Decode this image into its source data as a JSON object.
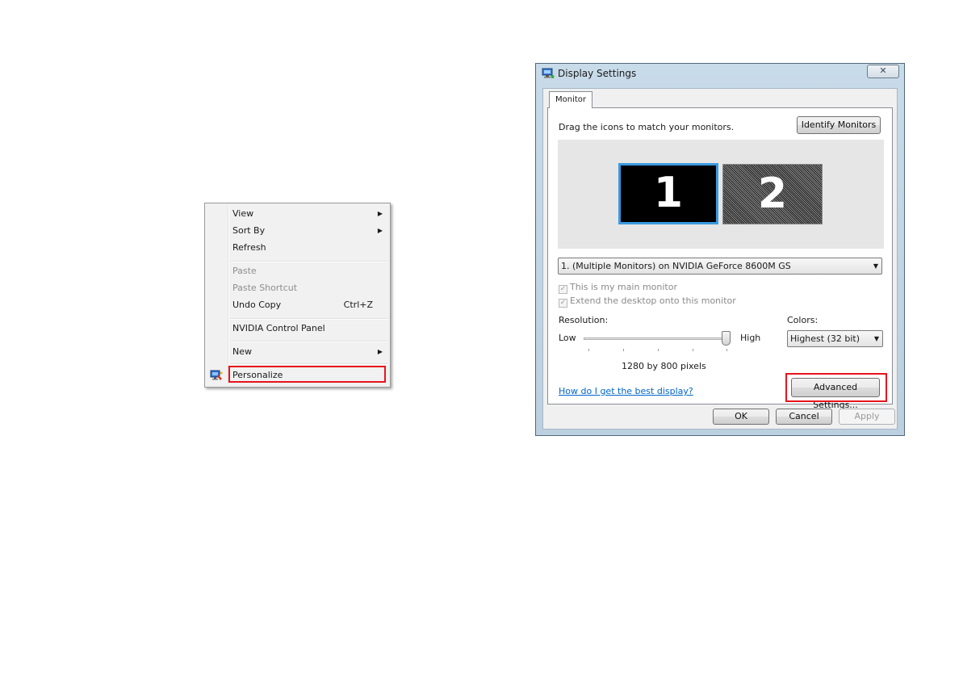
{
  "context_menu": {
    "items": [
      {
        "label": "View",
        "submenu": true
      },
      {
        "label": "Sort By",
        "submenu": true
      },
      {
        "label": "Refresh"
      },
      {
        "label": "Paste",
        "disabled": true
      },
      {
        "label": "Paste Shortcut",
        "disabled": true
      },
      {
        "label": "Undo Copy",
        "shortcut": "Ctrl+Z"
      },
      {
        "label": "NVIDIA Control Panel"
      },
      {
        "label": "New",
        "submenu": true
      },
      {
        "label": "Personalize",
        "highlighted": true,
        "icon": "personalize-icon"
      }
    ]
  },
  "dialog": {
    "title": "Display Settings",
    "close_glyph": "✕",
    "tab": "Monitor",
    "drag_text": "Drag the icons to match your monitors.",
    "identify_button": "Identify Monitors",
    "monitors": [
      {
        "number": "1",
        "selected": true
      },
      {
        "number": "2",
        "selected": false
      }
    ],
    "display_select": "1. (Multiple Monitors) on NVIDIA GeForce 8600M GS",
    "checkboxes": [
      {
        "label": "This is my main monitor",
        "checked": true,
        "disabled": true
      },
      {
        "label": "Extend the desktop onto this monitor",
        "checked": true,
        "disabled": true
      }
    ],
    "resolution": {
      "label": "Resolution:",
      "low": "Low",
      "high": "High",
      "value_text": "1280 by 800 pixels",
      "slider_position": 1.0
    },
    "colors": {
      "label": "Colors:",
      "selected": "Highest (32 bit)"
    },
    "help_link": "How do I get the best display?",
    "advanced_button": "Advanced Settings...",
    "ok_button": "OK",
    "cancel_button": "Cancel",
    "apply_button": "Apply"
  },
  "highlight_color": "#e8141c",
  "selection_color": "#3b9ae0"
}
